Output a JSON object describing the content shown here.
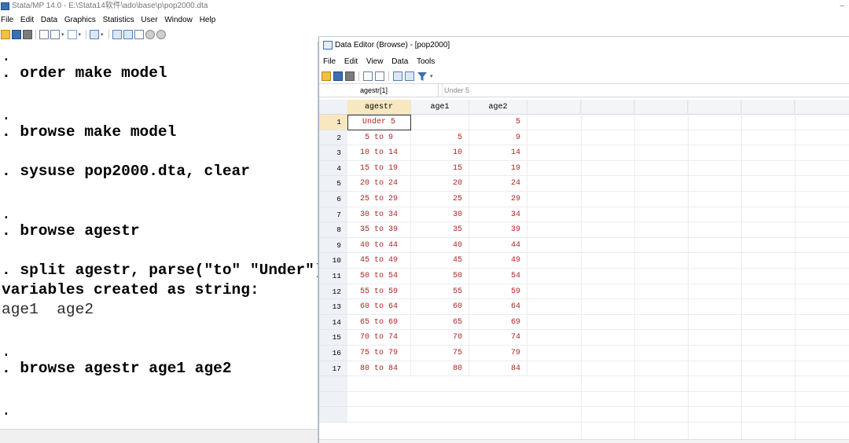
{
  "main_window": {
    "title": "Stata/MP 14.0 - E:\\Stata14软件\\ado\\base\\p\\pop2000.dta",
    "menu": [
      "File",
      "Edit",
      "Data",
      "Graphics",
      "Statistics",
      "User",
      "Window",
      "Help"
    ],
    "minimize_glyph": "–"
  },
  "results": {
    "lines": [
      {
        "text": ".",
        "kind": "plain"
      },
      {
        "text": ". order make model",
        "kind": "cmd"
      },
      {
        "text": "",
        "kind": "plain"
      },
      {
        "text": ".",
        "kind": "plain"
      },
      {
        "text": ". browse make model",
        "kind": "cmd"
      },
      {
        "text": "",
        "kind": "plain"
      },
      {
        "text": ". sysuse pop2000.dta, clear",
        "kind": "cmd"
      },
      {
        "text": "",
        "kind": "plain"
      },
      {
        "text": ".",
        "kind": "plain"
      },
      {
        "text": ". browse agestr",
        "kind": "cmd"
      },
      {
        "text": "",
        "kind": "plain"
      },
      {
        "text": ". split agestr, parse(\"to\" \"Under\")",
        "kind": "cmd"
      },
      {
        "text": "variables created as string:",
        "kind": "cmd"
      },
      {
        "text": "age1  age2",
        "kind": "muted"
      },
      {
        "text": "",
        "kind": "plain"
      },
      {
        "text": ".",
        "kind": "plain"
      },
      {
        "text": ". browse agestr age1 age2",
        "kind": "cmd"
      },
      {
        "text": "",
        "kind": "plain"
      },
      {
        "text": ".",
        "kind": "plain"
      }
    ]
  },
  "data_editor": {
    "title": "Data Editor (Browse) - [pop2000]",
    "menu": [
      "File",
      "Edit",
      "View",
      "Data",
      "Tools"
    ],
    "cell_ref": "agestr[1]",
    "cell_value": "Under 5",
    "columns": [
      "agestr",
      "age1",
      "age2"
    ],
    "rows": [
      {
        "n": "1",
        "agestr": "Under 5",
        "age1": "",
        "age2": "5"
      },
      {
        "n": "2",
        "agestr": "5 to 9",
        "age1": "5",
        "age2": "9"
      },
      {
        "n": "3",
        "agestr": "10 to 14",
        "age1": "10",
        "age2": "14"
      },
      {
        "n": "4",
        "agestr": "15 to 19",
        "age1": "15",
        "age2": "19"
      },
      {
        "n": "5",
        "agestr": "20 to 24",
        "age1": "20",
        "age2": "24"
      },
      {
        "n": "6",
        "agestr": "25 to 29",
        "age1": "25",
        "age2": "29"
      },
      {
        "n": "7",
        "agestr": "30 to 34",
        "age1": "30",
        "age2": "34"
      },
      {
        "n": "8",
        "agestr": "35 to 39",
        "age1": "35",
        "age2": "39"
      },
      {
        "n": "9",
        "agestr": "40 to 44",
        "age1": "40",
        "age2": "44"
      },
      {
        "n": "10",
        "agestr": "45 to 49",
        "age1": "45",
        "age2": "49"
      },
      {
        "n": "11",
        "agestr": "50 to 54",
        "age1": "50",
        "age2": "54"
      },
      {
        "n": "12",
        "agestr": "55 to 59",
        "age1": "55",
        "age2": "59"
      },
      {
        "n": "13",
        "agestr": "60 to 64",
        "age1": "60",
        "age2": "64"
      },
      {
        "n": "14",
        "agestr": "65 to 69",
        "age1": "65",
        "age2": "69"
      },
      {
        "n": "15",
        "agestr": "70 to 74",
        "age1": "70",
        "age2": "74"
      },
      {
        "n": "16",
        "agestr": "75 to 79",
        "age1": "75",
        "age2": "79"
      },
      {
        "n": "17",
        "agestr": "80 to 84",
        "age1": "80",
        "age2": "84"
      }
    ],
    "colors": {
      "data_text": "#b22222",
      "selected_header": "#f7e8bf"
    }
  }
}
